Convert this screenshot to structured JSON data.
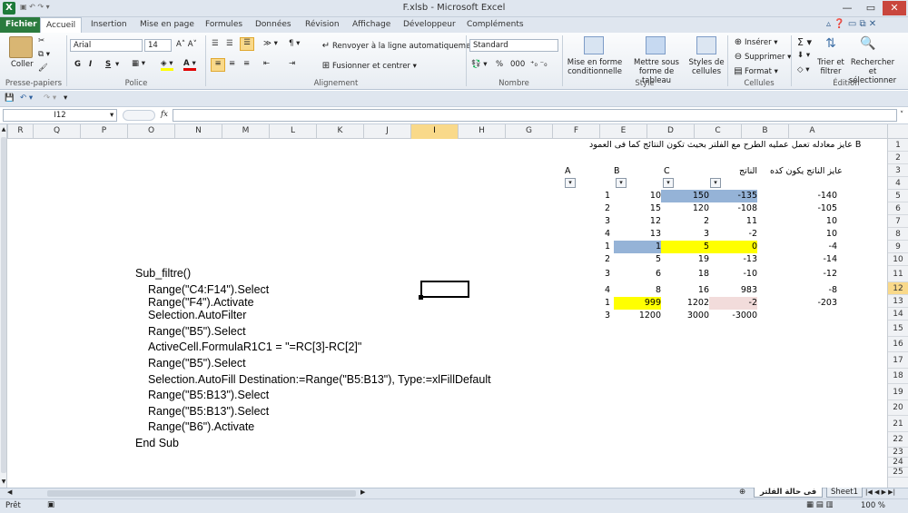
{
  "window": {
    "title": "F.xlsb - Microsoft Excel",
    "app_icon": "X"
  },
  "tabs": [
    {
      "label": "Fichier"
    },
    {
      "label": "Accueil"
    },
    {
      "label": "Insertion"
    },
    {
      "label": "Mise en page"
    },
    {
      "label": "Formules"
    },
    {
      "label": "Données"
    },
    {
      "label": "Révision"
    },
    {
      "label": "Affichage"
    },
    {
      "label": "Développeur"
    },
    {
      "label": "Compléments"
    }
  ],
  "ribbon": {
    "clipboard": {
      "paste": "Coller",
      "group": "Presse-papiers"
    },
    "font": {
      "name": "Arial",
      "size": "14",
      "bold": "G",
      "italic": "I",
      "underline": "S",
      "group": "Police"
    },
    "alignment": {
      "wrap": "Renvoyer à la ligne automatiquement",
      "merge": "Fusionner et centrer",
      "group": "Alignement"
    },
    "number": {
      "format": "Standard",
      "percent": "%",
      "thousands": "000",
      "group": "Nombre"
    },
    "style": {
      "conditional": "Mise en forme conditionnelle",
      "table": "Mettre sous forme de tableau",
      "cell_styles": "Styles de cellules",
      "group": "Style"
    },
    "cells": {
      "insert": "Insérer",
      "delete": "Supprimer",
      "format": "Format",
      "group": "Cellules"
    },
    "editing": {
      "sort": "Trier et filtrer",
      "find": "Rechercher et sélectionner",
      "group": "Édition"
    }
  },
  "formula_bar": {
    "name_box": "I12",
    "fx": "fx",
    "content": ""
  },
  "columns": [
    "R",
    "Q",
    "P",
    "O",
    "N",
    "M",
    "L",
    "K",
    "J",
    "I",
    "H",
    "G",
    "F",
    "E",
    "D",
    "C",
    "B",
    "A"
  ],
  "selected_column": "I",
  "rows": [
    "1",
    "2",
    "3",
    "4",
    "5",
    "6",
    "7",
    "8",
    "9",
    "10",
    "11",
    "12",
    "13",
    "14",
    "15",
    "16",
    "17",
    "18",
    "19",
    "20",
    "21",
    "22",
    "23",
    "24",
    "25"
  ],
  "selected_row": "12",
  "sheet": {
    "note": "عايز معادله تعمل عمليه الطرح مع الفلتر بحيث تكون النتائج كما فى العمود B",
    "hdr_a": "A",
    "hdr_b": "B",
    "hdr_c": "C",
    "hdr_result": "الناتج",
    "hdr_want": "عايز الناتج يكون كده",
    "table": [
      {
        "f": "1",
        "e": "10",
        "d": "150",
        "c": "-135",
        "b": "-140"
      },
      {
        "f": "2",
        "e": "15",
        "d": "120",
        "c": "-108",
        "b": "-105"
      },
      {
        "f": "3",
        "e": "12",
        "d": "2",
        "c": "11",
        "b": "10"
      },
      {
        "f": "4",
        "e": "13",
        "d": "3",
        "c": "-2",
        "b": "10"
      },
      {
        "f": "1",
        "e": "1",
        "d": "5",
        "c": "0",
        "b": "-4"
      },
      {
        "f": "2",
        "e": "5",
        "d": "19",
        "c": "-13",
        "b": "-14"
      },
      {
        "f": "3",
        "e": "6",
        "d": "18",
        "c": "-10",
        "b": "-12"
      },
      {
        "f": "4",
        "e": "8",
        "d": "16",
        "c": "983",
        "b": "-8"
      },
      {
        "f": "1",
        "e": "999",
        "d": "1202",
        "c": "-2",
        "b": "-203"
      },
      {
        "f": "3",
        "e": "1200",
        "d": "3000",
        "c": "-3000",
        "b": ""
      }
    ],
    "code": [
      "Sub_filtre()",
      "Range(\"C4:F14\").Select",
      "Range(\"F4\").Activate",
      "Selection.AutoFilter",
      "Range(\"B5\").Select",
      "ActiveCell.FormulaR1C1 = \"=RC[3]-RC[2]\"",
      "Range(\"B5\").Select",
      "Selection.AutoFill Destination:=Range(\"B5:B13\"), Type:=xlFillDefault",
      "Range(\"B5:B13\").Select",
      "Range(\"B5:B13\").Select",
      "Range(\"B6\").Activate",
      "End Sub"
    ]
  },
  "sheet_tabs": {
    "tab1": "فى حالة الفلتر",
    "tab2": "Sheet1"
  },
  "status": {
    "ready": "Prêt",
    "zoom": "100 %"
  }
}
